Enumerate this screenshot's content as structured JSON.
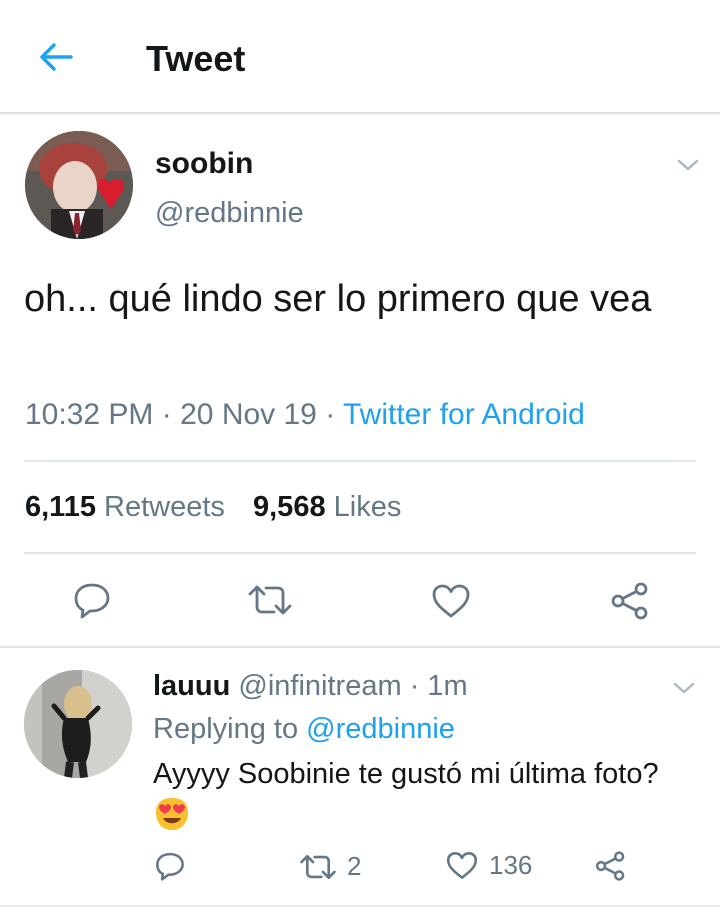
{
  "header": {
    "title": "Tweet",
    "back_icon": "arrow-left-icon",
    "accent": "#1da1f2"
  },
  "tweet": {
    "display_name": "soobin",
    "handle": "@redbinnie",
    "text": "oh... qué lindo ser lo primero que vea",
    "time": "10:32 PM",
    "date": "20 Nov 19",
    "separator": "·",
    "source": "Twitter for Android",
    "retweets_count": "6,115",
    "retweets_label": "Retweets",
    "likes_count": "9,568",
    "likes_label": "Likes"
  },
  "actions": [
    {
      "name": "reply",
      "icon": "reply-icon"
    },
    {
      "name": "retweet",
      "icon": "retweet-icon"
    },
    {
      "name": "like",
      "icon": "heart-icon"
    },
    {
      "name": "share",
      "icon": "share-icon"
    }
  ],
  "reply": {
    "display_name": "lauuu",
    "handle": "@infinitream",
    "separator": "·",
    "time": "1m",
    "replying_prefix": "Replying to",
    "replying_to": "@redbinnie",
    "text": "Ayyyy Soobinie te gustó mi última foto?",
    "emoji": "heart-eyes-emoji",
    "retweet_count": "2",
    "like_count": "136"
  }
}
